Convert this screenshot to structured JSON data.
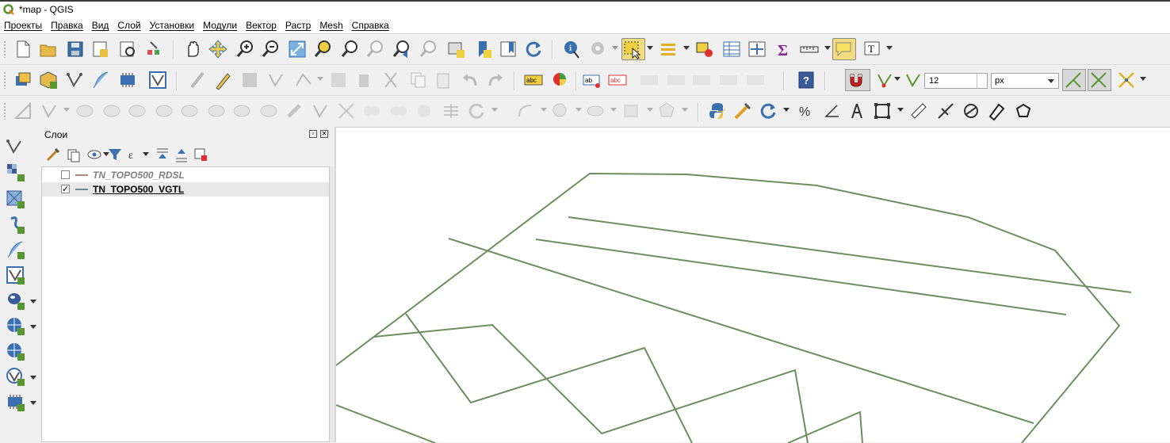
{
  "window": {
    "title": "*map - QGIS"
  },
  "menu": [
    "Проекты",
    "Правка",
    "Вид",
    "Слой",
    "Установки",
    "Модули",
    "Вектор",
    "Растр",
    "Mesh",
    "Справка"
  ],
  "snapping": {
    "tolerance_value": "12",
    "tolerance_unit": "px"
  },
  "layers_panel": {
    "title": "Слои",
    "layers": [
      {
        "name": "TN_TOPO500_RDSL",
        "checked": false,
        "symbol_color": "#a08a78"
      },
      {
        "name": "TN_TOPO500_VGTL",
        "checked": true,
        "symbol_color": "#6a8a9a"
      }
    ]
  },
  "colors": {
    "line_color": "#6b8f5e",
    "selection_highlight": "#f3dc7e",
    "qgis_green": "#589632"
  }
}
